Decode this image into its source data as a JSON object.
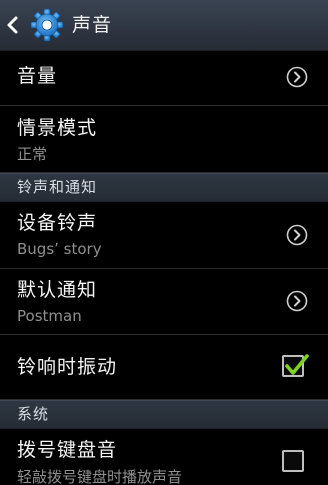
{
  "header": {
    "title": "声音",
    "back_icon": "back-chevron-icon",
    "app_icon": "settings-gear-icon"
  },
  "rows_top": [
    {
      "label": "音量",
      "trailing": "chevron-right-icon"
    },
    {
      "label": "情景模式",
      "subtitle": "正常"
    }
  ],
  "section_ringtones": {
    "title": "铃声和通知",
    "items": [
      {
        "label": "设备铃声",
        "subtitle": "Bugs’ story",
        "trailing": "chevron-right-icon"
      },
      {
        "label": "默认通知",
        "subtitle": "Postman",
        "trailing": "chevron-right-icon"
      },
      {
        "label": "铃响时振动",
        "checked": true
      }
    ]
  },
  "section_system": {
    "title": "系统",
    "items": [
      {
        "label": "拨号键盘音",
        "subtitle": "轻敲拨号键盘时播放声音",
        "checked": false
      }
    ]
  },
  "colors": {
    "accent_check": "#7ed321",
    "section_bg": "#2a323c",
    "secondary_text": "#8f8f8f"
  }
}
